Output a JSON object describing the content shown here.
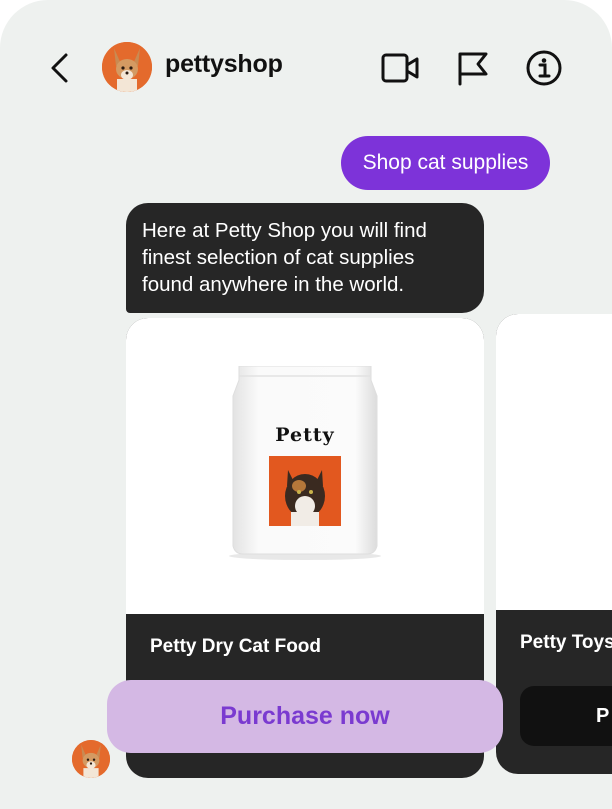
{
  "header": {
    "shop_name": "pettyshop",
    "icons": [
      "chevron-left-icon",
      "video-camera-icon",
      "flag-icon",
      "info-icon"
    ]
  },
  "messages": {
    "outgoing": "Shop cat supplies",
    "incoming": "Here at Petty Shop you will find finest selection of cat supplies found anywhere in the world."
  },
  "cards": [
    {
      "title": "Petty Dry Cat Food",
      "brand": "Petty",
      "button": "Purchase now"
    },
    {
      "title": "Petty Toys",
      "button": "P"
    }
  ],
  "colors": {
    "accent": "#7d33d9",
    "button_bg": "#d4b8e4",
    "button_text": "#7a3ad0",
    "bubble_dark": "#262626",
    "background": "#eef1ef"
  }
}
